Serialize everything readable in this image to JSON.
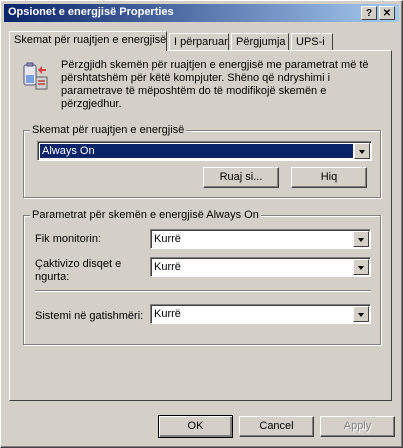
{
  "window": {
    "title": "Opsionet e energjisë Properties",
    "help_label": "?",
    "close_label": "✕"
  },
  "tabs": [
    {
      "label": "Skemat për ruajtjen e energjisë",
      "active": true
    },
    {
      "label": "I përparuar",
      "active": false
    },
    {
      "label": "Përgjumja",
      "active": false
    },
    {
      "label": "UPS-i",
      "active": false
    }
  ],
  "description": "Përzgjidh skemën për ruajtjen e energjisë me parametrat më të përshtatshëm për këtë kompjuter. Shëno që ndryshimi i parametrave të mëposhtëm do të modifikojë skemën e përzgjedhur.",
  "scheme_group": {
    "legend": "Skemat për ruajtjen e energjisë",
    "selected": "Always On",
    "save_label": "Ruaj si...",
    "delete_label": "Hiq"
  },
  "settings_group": {
    "legend": "Parametrat për skemën e energjisë Always On",
    "monitor_label": "Fik monitorin:",
    "monitor_value": "Kurrë",
    "disks_label": "Çaktivizo disqet e ngurta:",
    "disks_value": "Kurrë",
    "standby_label": "Sistemi në gatishmëri:",
    "standby_value": "Kurrë"
  },
  "footer": {
    "ok_label": "OK",
    "cancel_label": "Cancel",
    "apply_label": "Apply"
  }
}
